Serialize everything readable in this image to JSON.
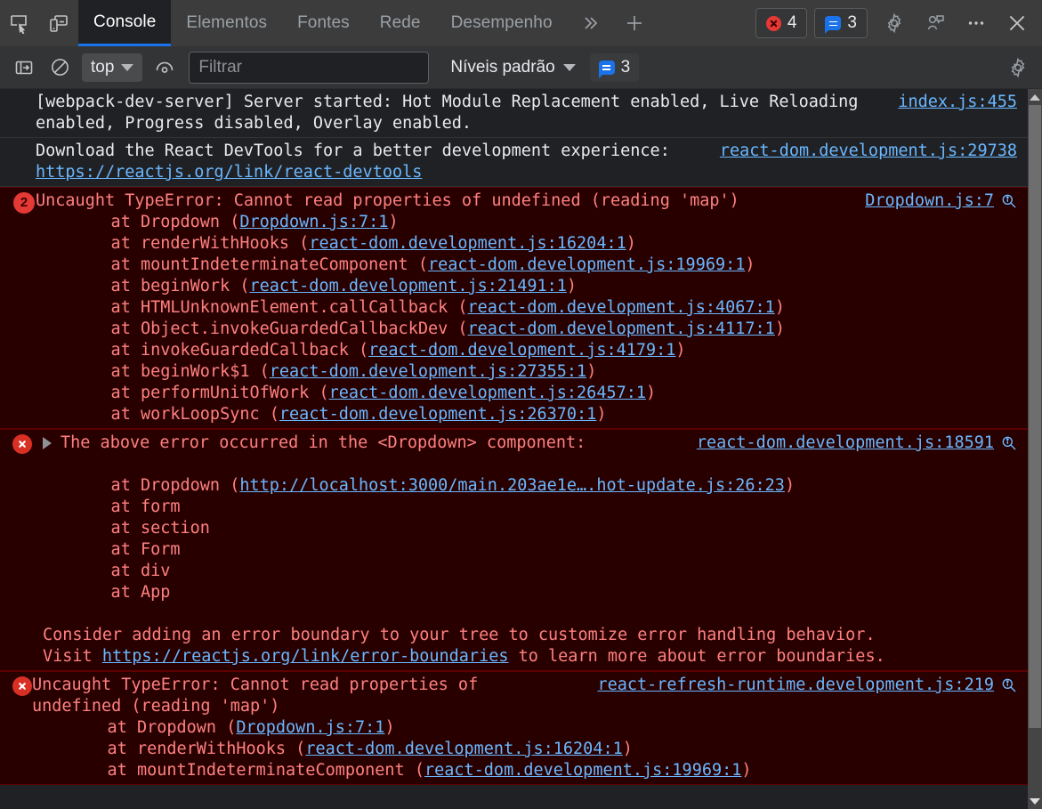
{
  "tabbar": {
    "inspect_icon": "inspect-element-icon",
    "device_icon": "device-toolbar-icon",
    "tabs": [
      {
        "label": "Console",
        "active": true
      },
      {
        "label": "Elementos",
        "active": false
      },
      {
        "label": "Fontes",
        "active": false
      },
      {
        "label": "Rede",
        "active": false
      },
      {
        "label": "Desempenho",
        "active": false
      }
    ],
    "more_tabs_icon": "chevron-double-right-icon",
    "new_tab_icon": "plus-icon",
    "error_count": "4",
    "message_count": "3",
    "settings_icon": "gear-icon",
    "feedback_icon": "feedback-icon",
    "more_icon": "ellipsis-icon",
    "close_icon": "close-icon"
  },
  "console_toolbar": {
    "sidebar_icon": "console-sidebar-icon",
    "clear_icon": "clear-console-icon",
    "context": "top",
    "eye_icon": "live-expression-icon",
    "filter_placeholder": "Filtrar",
    "filter_value": "",
    "levels_label": "Níveis padrão",
    "message_count": "3",
    "settings_icon": "gear-icon"
  },
  "messages": [
    {
      "type": "log",
      "text": "[webpack-dev-server] Server started: Hot Module Replacement enabled, Live Reloading enabled, Progress disabled, Overlay enabled.",
      "source": "index.js:455"
    },
    {
      "type": "log",
      "text_before": "Download the React DevTools for a better development experience: ",
      "link": "https://reactjs.org/link/react-devtools",
      "source": "react-dom.development.js:29738"
    },
    {
      "type": "error",
      "count": "2",
      "title": "Uncaught TypeError: Cannot read properties of undefined (reading 'map')",
      "source": "Dropdown.js:7",
      "stack": [
        {
          "fn": "    at Dropdown (",
          "link": "Dropdown.js:7:1",
          "close": ")"
        },
        {
          "fn": "    at renderWithHooks (",
          "link": "react-dom.development.js:16204:1",
          "close": ")"
        },
        {
          "fn": "    at mountIndeterminateComponent (",
          "link": "react-dom.development.js:19969:1",
          "close": ")"
        },
        {
          "fn": "    at beginWork (",
          "link": "react-dom.development.js:21491:1",
          "close": ")"
        },
        {
          "fn": "    at HTMLUnknownElement.callCallback (",
          "link": "react-dom.development.js:4067:1",
          "close": ")"
        },
        {
          "fn": "    at Object.invokeGuardedCallbackDev (",
          "link": "react-dom.development.js:4117:1",
          "close": ")"
        },
        {
          "fn": "    at invokeGuardedCallback (",
          "link": "react-dom.development.js:4179:1",
          "close": ")"
        },
        {
          "fn": "    at beginWork$1 (",
          "link": "react-dom.development.js:27355:1",
          "close": ")"
        },
        {
          "fn": "    at performUnitOfWork (",
          "link": "react-dom.development.js:26457:1",
          "close": ")"
        },
        {
          "fn": "    at workLoopSync (",
          "link": "react-dom.development.js:26370:1",
          "close": ")"
        }
      ]
    },
    {
      "type": "error",
      "expandable": true,
      "title": "The above error occurred in the <Dropdown> component:",
      "source": "react-dom.development.js:18591",
      "stack": [
        {
          "fn": "    at Dropdown (",
          "link": "http://localhost:3000/main.203ae1e….hot-update.js:26:23",
          "close": ")"
        },
        {
          "fn": "    at form",
          "link": "",
          "close": ""
        },
        {
          "fn": "    at section",
          "link": "",
          "close": ""
        },
        {
          "fn": "    at Form",
          "link": "",
          "close": ""
        },
        {
          "fn": "    at div",
          "link": "",
          "close": ""
        },
        {
          "fn": "    at App",
          "link": "",
          "close": ""
        }
      ],
      "footer_line1": "Consider adding an error boundary to your tree to customize error handling behavior.",
      "footer_visit": "Visit ",
      "footer_link": "https://reactjs.org/link/error-boundaries",
      "footer_tail": " to learn more about error boundaries."
    },
    {
      "type": "error",
      "title": "Uncaught TypeError: Cannot read properties of undefined (reading 'map')",
      "source": "react-refresh-runtime.development.js:219",
      "stack": [
        {
          "fn": "    at Dropdown (",
          "link": "Dropdown.js:7:1",
          "close": ")"
        },
        {
          "fn": "    at renderWithHooks (",
          "link": "react-dom.development.js:16204:1",
          "close": ")"
        },
        {
          "fn": "    at mountIndeterminateComponent (",
          "link": "react-dom.development.js:19969:1",
          "close": ")"
        }
      ]
    }
  ],
  "colors": {
    "accent": "#1a73e8",
    "error_bg": "#290000",
    "error_text": "#ff8080",
    "link": "#6ab7ff"
  }
}
